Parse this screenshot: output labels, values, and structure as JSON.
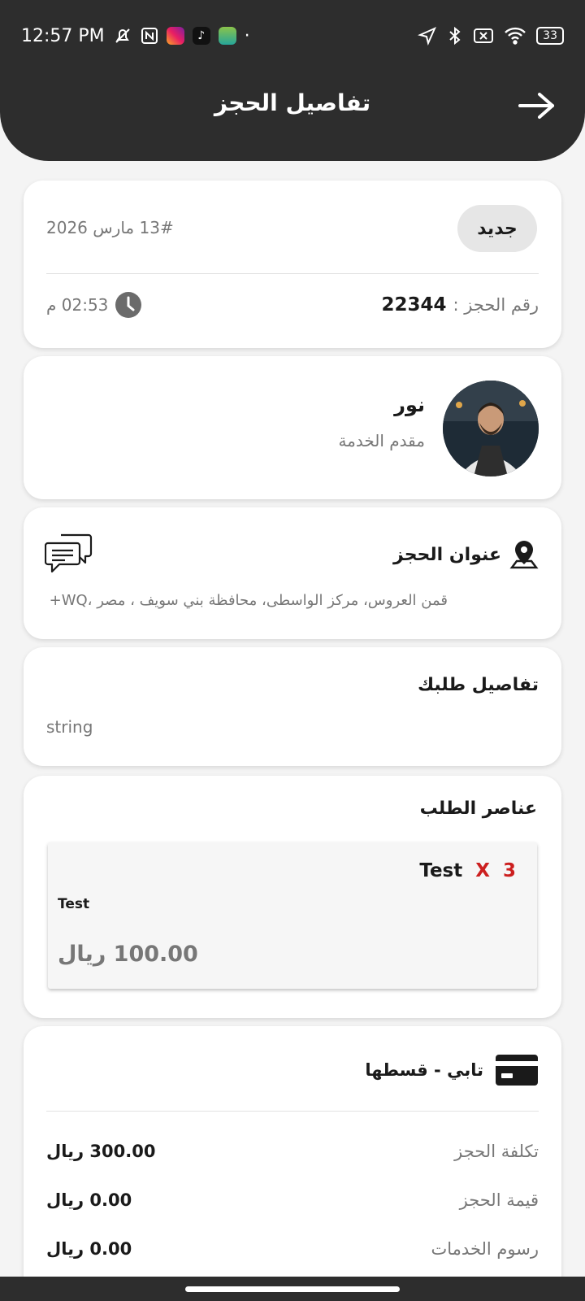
{
  "status_bar": {
    "time": "12:57 PM",
    "battery": "33",
    "dot": "·"
  },
  "header": {
    "title": "تفاصيل الحجز"
  },
  "booking": {
    "status_badge": "جديد",
    "date": "13# مارس 2026",
    "number_label": "رقم الحجز :",
    "number_value": "22344",
    "time": "02:53 م"
  },
  "provider": {
    "name": "نور",
    "role": "مقدم الخدمة"
  },
  "address": {
    "title": "عنوان الحجز",
    "text": "قمن العروس، مركز الواسطى، محافظة بني سويف ، مصر ،WQ+"
  },
  "request": {
    "title": "تفاصيل طلبك",
    "text": "string"
  },
  "order_items": {
    "title": "عناصر الطلب",
    "items": [
      {
        "quantity": "3",
        "times": "X",
        "name": "Test",
        "description": "Test",
        "price": "100.00 ريال"
      }
    ]
  },
  "payment": {
    "method": "تابي - قسطها",
    "rows": [
      {
        "label": "تكلفة الحجز",
        "value": "300.00 ريال"
      },
      {
        "label": "قيمة الحجز",
        "value": "0.00 ريال"
      },
      {
        "label": "رسوم الخدمات",
        "value": "0.00 ريال"
      }
    ]
  },
  "colors": {
    "header_bg": "#2d2d2d",
    "accent_red": "#cc1f1f",
    "badge_bg": "#e6e6e6"
  },
  "icons": {
    "back": "arrow-right-icon",
    "clock": "clock-icon",
    "location": "location-pin-icon",
    "chat": "chat-icon",
    "card": "credit-card-icon"
  }
}
